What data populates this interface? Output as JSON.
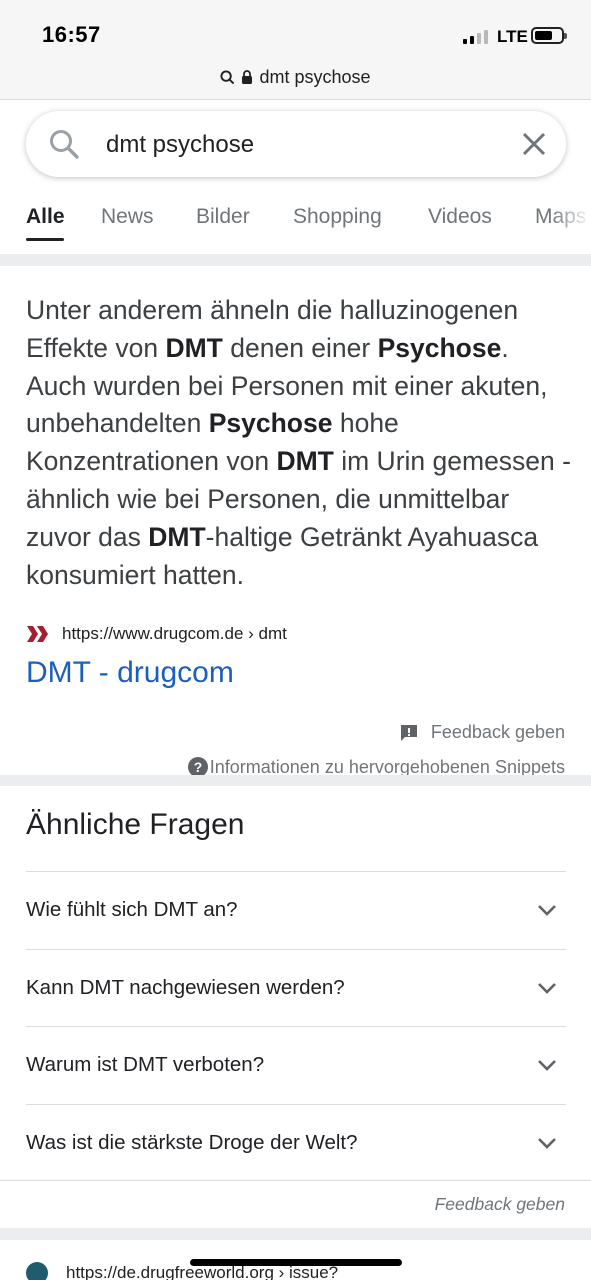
{
  "status_bar": {
    "time": "16:57",
    "network": "LTE",
    "signal_icon": "signal-bars-icon",
    "battery_icon": "battery-icon"
  },
  "url_bar": {
    "url": "dmt psychose",
    "search_icon": "search-icon",
    "lock_icon": "lock-icon"
  },
  "search": {
    "query": "dmt psychose",
    "search_icon": "search-icon",
    "clear_icon": "close-icon"
  },
  "tabs": [
    {
      "label": "Alle",
      "active": true
    },
    {
      "label": "News"
    },
    {
      "label": "Bilder"
    },
    {
      "label": "Shopping"
    },
    {
      "label": "Videos"
    },
    {
      "label": "Maps"
    }
  ],
  "snippet": {
    "segments": [
      "Unter anderem ähneln die halluzinogenen Effekte von ",
      "DMT",
      " denen einer ",
      "Psychose",
      ". Auch wurden bei Personen mit einer akuten, unbehandelten ",
      "Psychose",
      " hohe Konzentrationen von ",
      "DMT",
      " im Urin gemessen - ähnlich wie bei Personen, die unmittelbar zuvor das ",
      "DMT",
      "-haltige Getränkt Ayahuasca konsumiert hatten."
    ],
    "source_url": "https://www.drugcom.de › dmt",
    "favicon": "drugcom-favicon",
    "link_title": "DMT - drugcom",
    "feedback": "Feedback geben",
    "feedback_icon": "feedback-icon",
    "info": "Informationen zu hervorgehobenen Snippets",
    "info_icon": "help-icon"
  },
  "related_questions": {
    "title": "Ähnliche Fragen",
    "items": [
      "Wie fühlt sich DMT an?",
      "Kann DMT nachgewiesen werden?",
      "Warum ist DMT verboten?",
      "Was ist die stärkste Droge der Welt?"
    ],
    "chevron_icon": "chevron-down-icon",
    "feedback": "Feedback geben"
  },
  "next_result": {
    "url": "https://de.drugfreeworld.org › issue?",
    "favicon": "globe-icon"
  },
  "colors": {
    "link": "#1a5fbd",
    "text": "#202124",
    "muted": "#70757a",
    "divider": "#dadce0",
    "drugcom_red": "#a3202e"
  }
}
